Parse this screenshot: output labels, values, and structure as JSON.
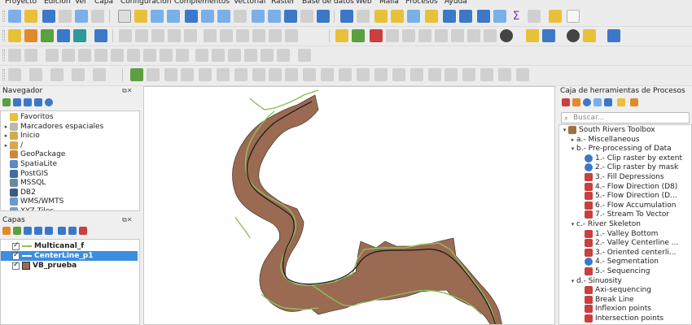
{
  "menu": [
    "Proyecto",
    "Edición",
    "Ver",
    "Capa",
    "Configuración",
    "Complementos",
    "Vectorial",
    "Ráster",
    "Base de datos",
    "Web",
    "Malla",
    "Procesos",
    "Ayuda"
  ],
  "navigator": {
    "title": "Navegador",
    "items": [
      {
        "label": "Favoritos",
        "icon": "star-icon",
        "arrow": ""
      },
      {
        "label": "Marcadores espaciales",
        "icon": "bookmark-icon",
        "arrow": "▸"
      },
      {
        "label": "Inicio",
        "icon": "home-folder-icon",
        "arrow": "▸"
      },
      {
        "label": "/",
        "icon": "folder-icon",
        "arrow": "▸"
      },
      {
        "label": "GeoPackage",
        "icon": "geopackage-icon",
        "arrow": ""
      },
      {
        "label": "SpatiaLite",
        "icon": "spatialite-icon",
        "arrow": ""
      },
      {
        "label": "PostGIS",
        "icon": "postgis-icon",
        "arrow": ""
      },
      {
        "label": "MSSQL",
        "icon": "mssql-icon",
        "arrow": ""
      },
      {
        "label": "DB2",
        "icon": "db2-icon",
        "arrow": ""
      },
      {
        "label": "WMS/WMTS",
        "icon": "wms-icon",
        "arrow": ""
      },
      {
        "label": "XYZ Tiles",
        "icon": "xyz-tiles-icon",
        "arrow": "▸"
      }
    ]
  },
  "layers": {
    "title": "Capas",
    "items": [
      {
        "label": "Multicanal_f",
        "symbol": "line",
        "color": "#8fbf5a",
        "selected": false
      },
      {
        "label": "CenterLine_p1",
        "symbol": "line",
        "color": "#1a1a1a",
        "selected": true
      },
      {
        "label": "VB_prueba",
        "symbol": "fill",
        "color": "#9a6a52",
        "selected": false
      }
    ]
  },
  "toolbox": {
    "title": "Caja de herramientas de Procesos",
    "search_placeholder": "Buscar...",
    "tree": [
      {
        "label": "South Rivers Toolbox",
        "level": 0,
        "arrow": "▾",
        "icon": "toolbox-icon"
      },
      {
        "label": "a.- Miscellaneous",
        "level": 1,
        "arrow": "▸",
        "icon": ""
      },
      {
        "label": "b.- Pre-processing of Data",
        "level": 1,
        "arrow": "▾",
        "icon": ""
      },
      {
        "label": "1.- Clip raster by extent",
        "level": 2,
        "arrow": "",
        "icon": "gear-icon"
      },
      {
        "label": "2.- Clip raster by mask",
        "level": 2,
        "arrow": "",
        "icon": "gear-icon"
      },
      {
        "label": "3.- Fill Depressions",
        "level": 2,
        "arrow": "",
        "icon": "model-icon"
      },
      {
        "label": "4.- Flow Direction (D8)",
        "level": 2,
        "arrow": "",
        "icon": "model-icon"
      },
      {
        "label": "5.- Flow Direction (D...",
        "level": 2,
        "arrow": "",
        "icon": "model-icon"
      },
      {
        "label": "6.- Flow Accumulation",
        "level": 2,
        "arrow": "",
        "icon": "model-icon"
      },
      {
        "label": "7.- Stream To Vector",
        "level": 2,
        "arrow": "",
        "icon": "model-icon"
      },
      {
        "label": "c.- River Skeleton",
        "level": 1,
        "arrow": "▾",
        "icon": ""
      },
      {
        "label": "1.- Valley Bottom",
        "level": 2,
        "arrow": "",
        "icon": "model-icon"
      },
      {
        "label": "2.- Valley Centerline ...",
        "level": 2,
        "arrow": "",
        "icon": "model-icon"
      },
      {
        "label": "3.- Oriented centerli...",
        "level": 2,
        "arrow": "",
        "icon": "model-icon"
      },
      {
        "label": "4.- Segmentation",
        "level": 2,
        "arrow": "",
        "icon": "gear-icon"
      },
      {
        "label": "5.- Sequencing",
        "level": 2,
        "arrow": "",
        "icon": "model-icon"
      },
      {
        "label": "d.- Sinuosity",
        "level": 1,
        "arrow": "▾",
        "icon": ""
      },
      {
        "label": "Axi-sequencing",
        "level": 2,
        "arrow": "",
        "icon": "model-icon"
      },
      {
        "label": "Break Line",
        "level": 2,
        "arrow": "",
        "icon": "model-icon"
      },
      {
        "label": "Inflexion points",
        "level": 2,
        "arrow": "",
        "icon": "model-icon"
      },
      {
        "label": "Intersection points",
        "level": 2,
        "arrow": "",
        "icon": "model-icon"
      }
    ]
  },
  "colors": {
    "valley_fill": "#9a6a52",
    "valley_stroke": "#3a2a22",
    "multichannel": "#8fbf5a",
    "centerline": "#1a1a1a",
    "selection": "#3d8ee0"
  }
}
